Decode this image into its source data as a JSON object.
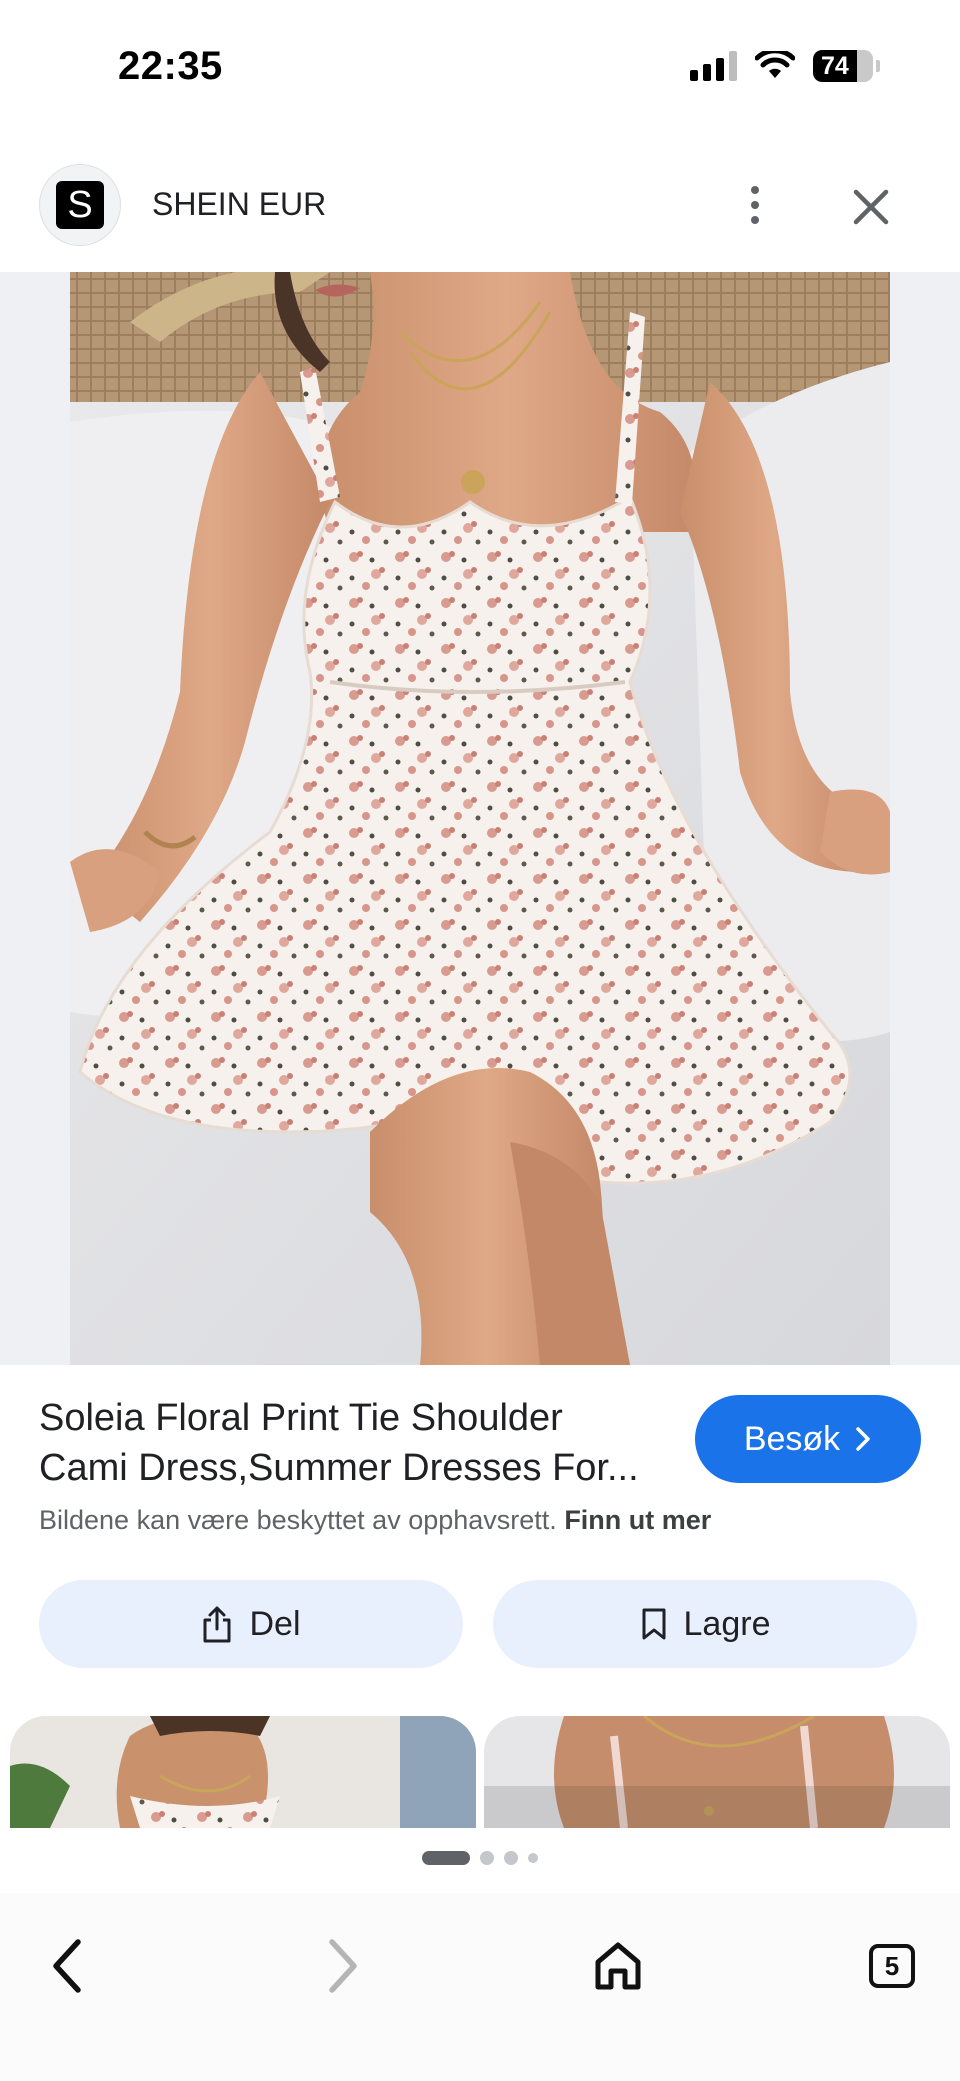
{
  "status_bar": {
    "time": "22:35",
    "battery": "74",
    "battery_level": 0.74,
    "icons": [
      "signal-icon",
      "wifi-icon",
      "battery-icon"
    ]
  },
  "header": {
    "logo_letter": "S",
    "site_name": "SHEIN EUR",
    "icons": [
      "more-vertical-icon",
      "close-icon"
    ]
  },
  "product": {
    "title_line1": "Soleia Floral Print Tie Shoulder",
    "title_line2": "Cami Dress,Summer Dresses For...",
    "visit_label": "Besøk",
    "copyright_text": "Bildene kan være beskyttet av opphavsrett.",
    "learn_more": "Finn ut mer"
  },
  "actions": {
    "share_label": "Del",
    "save_label": "Lagre"
  },
  "pagination": {
    "count": 4,
    "active_index": 0
  },
  "bottom_nav": {
    "tabs_count": "5",
    "icons": [
      "back-icon",
      "forward-icon",
      "home-icon",
      "tabs-icon"
    ]
  },
  "colors": {
    "accent": "#1a73e8",
    "pill_bg": "#e8f0fe"
  }
}
